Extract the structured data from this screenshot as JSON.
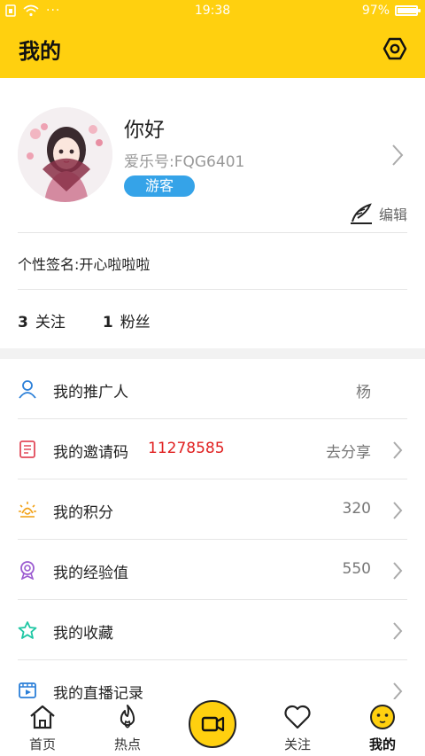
{
  "status_bar": {
    "time": "19:38",
    "battery": "97%",
    "battery_level": 0.97
  },
  "header": {
    "title": "我的"
  },
  "profile": {
    "nickname": "你好",
    "account_id": "爱乐号:FQG6401",
    "badge": "游客",
    "edit_label": "编辑",
    "signature": "个性签名:开心啦啦啦",
    "following_count": "3",
    "following_label": "关注",
    "fans_count": "1",
    "fans_label": "粉丝"
  },
  "menu": [
    {
      "label": "我的推广人",
      "value": "杨",
      "icon": "person-icon"
    },
    {
      "label": "我的邀请码",
      "code": "11278585",
      "value": "去分享",
      "icon": "invite-code-icon"
    },
    {
      "label": "我的积分",
      "value": "320",
      "icon": "points-sun-icon"
    },
    {
      "label": "我的经验值",
      "value": "550",
      "icon": "badge-icon"
    },
    {
      "label": "我的收藏",
      "value": "",
      "icon": "star-icon"
    },
    {
      "label": "我的直播记录",
      "value": "",
      "icon": "video-record-icon"
    }
  ],
  "tabbar": {
    "home": "首页",
    "hot": "热点",
    "follow": "关注",
    "mine": "我的"
  },
  "colors": {
    "accent": "#FFD00F",
    "badge": "#35A3E8",
    "code": "#e02020"
  }
}
